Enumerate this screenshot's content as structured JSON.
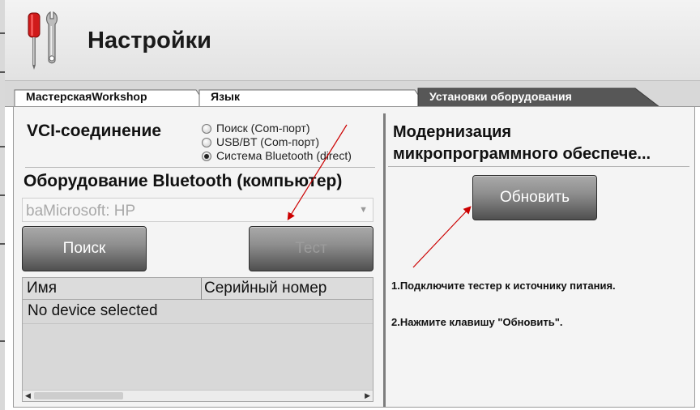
{
  "window": {
    "title": "Настройки"
  },
  "tabs": [
    {
      "label": "МастерскаяWorkshop",
      "active": false
    },
    {
      "label": "Язык",
      "active": false
    },
    {
      "label": "Установки оборудования",
      "active": true
    }
  ],
  "vci": {
    "title": "VCI-соединение",
    "options": [
      {
        "label": "Поиск (Com-порт)",
        "checked": false
      },
      {
        "label": "USB/BT (Com-порт)",
        "checked": false
      },
      {
        "label": "Система Bluetooth (direct)",
        "checked": true
      }
    ]
  },
  "bluetooth": {
    "title": "Оборудование Bluetooth (компьютер)",
    "select_value": "baMicrosoft: HP",
    "search_button": "Поиск",
    "test_button": "Тест"
  },
  "device_table": {
    "columns": [
      "Имя",
      "Серийный номер"
    ],
    "rows": [
      "No device selected"
    ]
  },
  "firmware": {
    "title_line1": "Модернизация",
    "title_line2": "микропрограммного обеспече...",
    "update_button": "Обновить",
    "instructions": [
      "1.Подключите тестер к источнику питания.",
      "2.Нажмите клавишу \"Обновить\"."
    ]
  },
  "icons": {
    "header": "screwdriver-wrench-icon",
    "select_arrow": "chevron-down-icon",
    "scroll_left": "arrow-left-icon",
    "scroll_right": "arrow-right-icon"
  },
  "colors": {
    "active_tab": "#555555",
    "button_top": "#a9a9a9",
    "button_bottom": "#4f4f4f",
    "annotation_arrow": "#cc0000"
  }
}
